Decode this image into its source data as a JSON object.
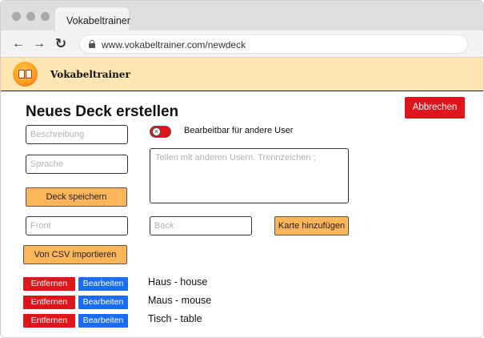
{
  "browser": {
    "tab_title": "Vokabeltrainer",
    "url": "www.vokabeltrainer.com/newdeck",
    "back_icon": "←",
    "forward_icon": "→",
    "reload_icon": "↻"
  },
  "header": {
    "app_name": "Vokabeltrainer"
  },
  "page": {
    "title": "Neues Deck erstellen",
    "cancel_label": "Abbrechen"
  },
  "form": {
    "description_placeholder": "Beschreibung",
    "language_placeholder": "Sprache",
    "editable_toggle_label": "Bearbeitbar für andere User",
    "editable_toggle_state": "off",
    "share_placeholder": "Teilen mit anderen Usern. Trennzeichen ;",
    "save_deck_label": "Deck speichern",
    "front_placeholder": "Front",
    "back_placeholder": "Back",
    "add_card_label": "Karte hinzufügen",
    "import_csv_label": "Von CSV importieren"
  },
  "cards": [
    {
      "remove_label": "Entfernen",
      "edit_label": "Bearbeiten",
      "text": "Haus - house"
    },
    {
      "remove_label": "Entfernen",
      "edit_label": "Bearbeiten",
      "text": "Maus - mouse"
    },
    {
      "remove_label": "Entfernen",
      "edit_label": "Bearbeiten",
      "text": "Tisch - table"
    }
  ],
  "colors": {
    "header_bg": "#fde6b2",
    "accent_orange": "#fdb55a",
    "danger_red": "#e0151b",
    "edit_blue": "#1a6cf2"
  }
}
